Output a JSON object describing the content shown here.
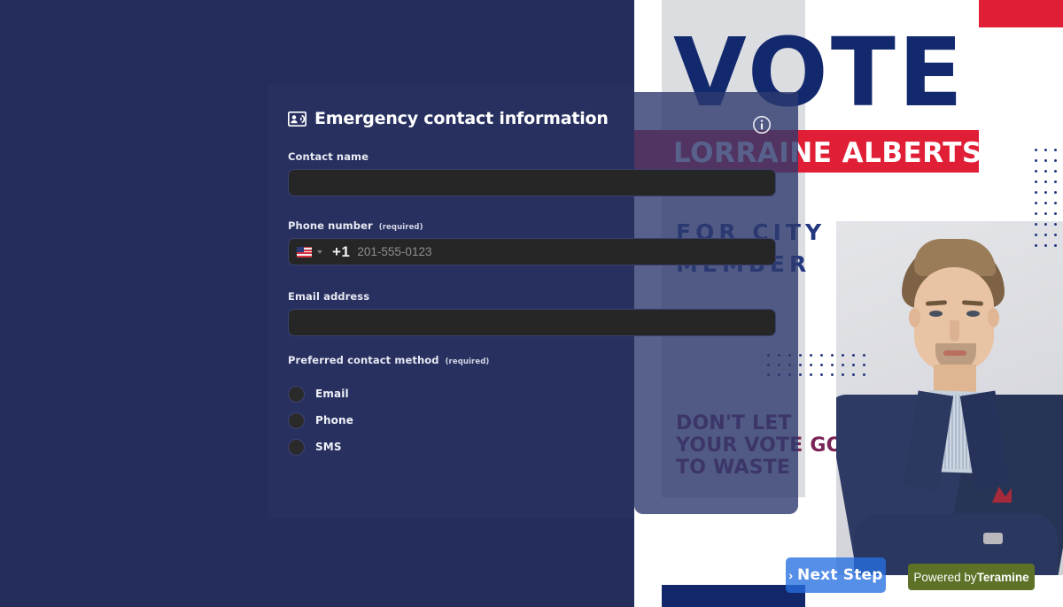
{
  "form": {
    "heading": "Emergency contact information",
    "heading_icon": "contact-card-icon",
    "fields": {
      "contact_name": {
        "label": "Contact name",
        "value": "",
        "placeholder": ""
      },
      "phone_number": {
        "label": "Phone number",
        "required_note": "(required)",
        "country_flag": "us-flag-icon",
        "dial_code": "+1",
        "placeholder": "201-555-0123",
        "value": ""
      },
      "email_address": {
        "label": "Email address",
        "value": "",
        "placeholder": ""
      }
    },
    "preferred_contact_method": {
      "label": "Preferred contact method",
      "required_note": "(required)",
      "options": [
        {
          "label": "Email",
          "selected": false
        },
        {
          "label": "Phone",
          "selected": false
        },
        {
          "label": "SMS",
          "selected": false
        }
      ]
    }
  },
  "poster": {
    "vote_word": "VOTE",
    "candidate_name": "LORRAINE ALBERTS",
    "role_line1": "FOR CITY",
    "role_line2": "MEMBER",
    "slogan": "DON'T LET YOUR VOTE GO TO WASTE",
    "info_icon": "info-circle-icon"
  },
  "controls": {
    "next_step": {
      "label": "Next Step",
      "chevron": "›"
    },
    "powered_by": {
      "prefix": "Powered by",
      "brand": "Teramine"
    }
  },
  "colors": {
    "page_navy": "#242d5c",
    "panel_navy": "#27305f",
    "input_dark": "#262626",
    "poster_blue": "#13296e",
    "poster_red": "#e01f36",
    "slogan_purple": "#7a2458",
    "next_step_blue": "#256fe0",
    "powered_olive": "#5d7127"
  }
}
